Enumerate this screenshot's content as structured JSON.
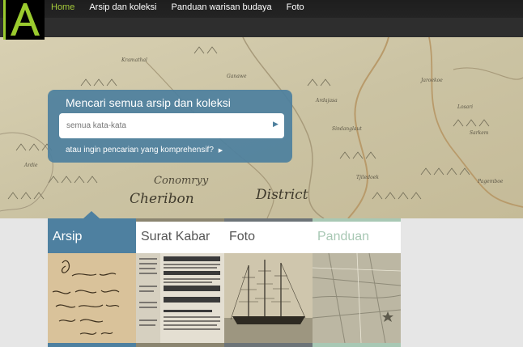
{
  "logo": {
    "letter": "A"
  },
  "nav": {
    "items": [
      {
        "label": "Home",
        "active": true
      },
      {
        "label": "Arsip dan koleksi",
        "active": false
      },
      {
        "label": "Panduan warisan budaya",
        "active": false
      },
      {
        "label": "Foto",
        "active": false
      }
    ]
  },
  "hero": {
    "map_labels": [
      "Cheribon",
      "District",
      "Conomryy"
    ]
  },
  "search": {
    "title": "Mencari semua arsip dan koleksi",
    "placeholder": "semua kata-kata",
    "go_icon": "triangle-right-icon",
    "advanced_link": "atau ingin pencarian yang komprehensif?"
  },
  "cards": [
    {
      "label": "Arsip",
      "color": "#4e80a0",
      "active": true
    },
    {
      "label": "Surat Kabar",
      "color": "#8b8570",
      "active": false
    },
    {
      "label": "Foto",
      "color": "#6d7478",
      "active": false
    },
    {
      "label": "Panduan",
      "color": "#a8c8b4",
      "active": false
    }
  ],
  "colors": {
    "accent": "#a3c83a",
    "panel": "#4e809e"
  }
}
